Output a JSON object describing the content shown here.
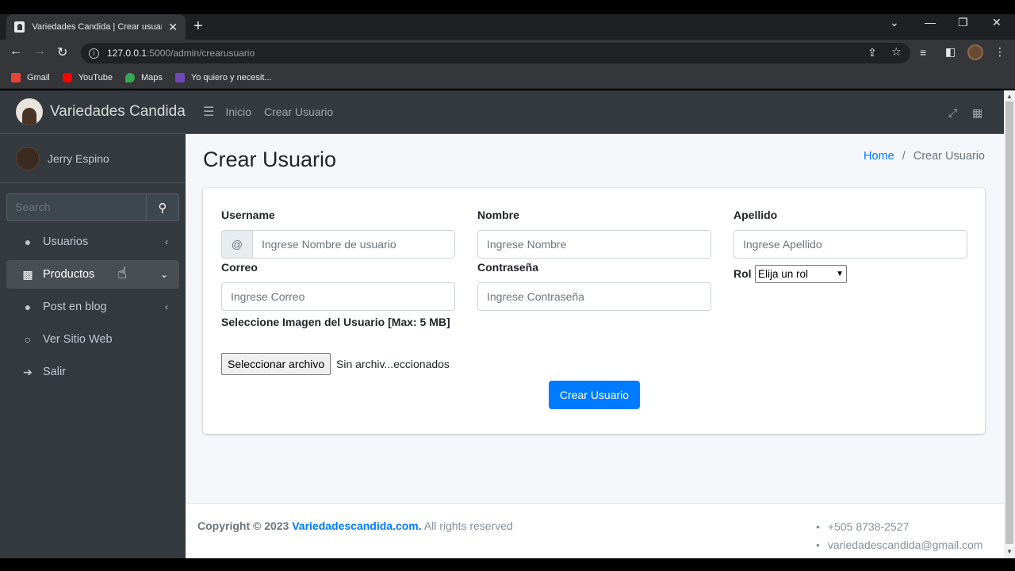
{
  "browser": {
    "tab_title": "Variedades Candida | Crear usuario",
    "url_host": "127.0.0.1",
    "url_path": ":5000/admin/crearusuario",
    "bookmarks": [
      "Gmail",
      "YouTube",
      "Maps",
      "Yo quiero y necesit..."
    ]
  },
  "brand": {
    "name": "Variedades Candida"
  },
  "user": {
    "name": "Jerry Espino"
  },
  "sidebar": {
    "search_placeholder": "Search",
    "items": [
      {
        "label": "Usuarios",
        "icon": "user-icon",
        "arrow": "‹"
      },
      {
        "label": "Productos",
        "icon": "store-icon",
        "arrow": "⌄"
      },
      {
        "label": "Post en blog",
        "icon": "user-icon",
        "arrow": "‹"
      },
      {
        "label": "Ver Sitio Web",
        "icon": "circle-icon",
        "arrow": ""
      },
      {
        "label": "Salir",
        "icon": "arrow-right-icon",
        "arrow": ""
      }
    ]
  },
  "topnav": {
    "links": [
      "Inicio",
      "Crear Usuario"
    ]
  },
  "page": {
    "title": "Crear Usuario",
    "breadcrumb_home": "Home",
    "breadcrumb_sep": "/",
    "breadcrumb_current": "Crear Usuario"
  },
  "form": {
    "username_label": "Username",
    "username_addon": "@",
    "username_placeholder": "Ingrese Nombre de usuario",
    "nombre_label": "Nombre",
    "nombre_placeholder": "Ingrese Nombre",
    "apellido_label": "Apellido",
    "apellido_placeholder": "Ingrese Apellido",
    "correo_label": "Correo",
    "correo_placeholder": "Ingrese Correo",
    "contrasena_label": "Contraseña",
    "contrasena_placeholder": "Ingrese Contraseña",
    "rol_label": "Rol",
    "rol_selected": "Elija un rol",
    "imagen_label": "Seleccione Imagen del Usuario [Max: 5 MB]",
    "file_button": "Seleccionar archivo",
    "file_status": "Sin archiv...eccionados",
    "submit": "Crear Usuario"
  },
  "footer": {
    "copyright_prefix": "Copyright © 2023",
    "site": "Variedadescandida.com.",
    "rights": "All rights reserved",
    "phone": "+505 8738-2527",
    "email": "variedadescandida@gmail.com"
  },
  "colors": {
    "primary": "#007bff",
    "sidebar": "#343a40",
    "content_bg": "#f4f6f9"
  }
}
